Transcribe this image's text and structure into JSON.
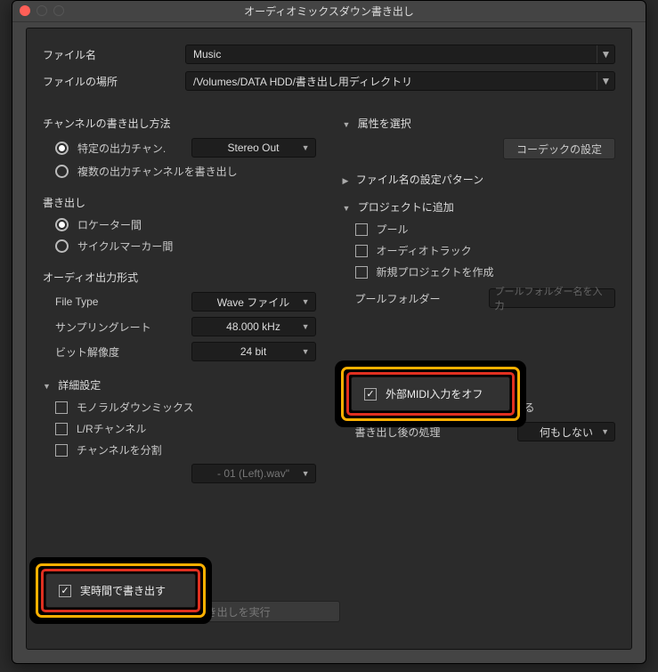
{
  "window": {
    "title": "オーディオミックスダウン書き出し"
  },
  "file": {
    "name_label": "ファイル名",
    "name_value": "Music",
    "path_label": "ファイルの場所",
    "path_value": "/Volumes/DATA HDD/書き出し用ディレクトリ"
  },
  "left": {
    "channel_method": "チャンネルの書き出し方法",
    "specific_channel": "特定の出力チャン.",
    "stereo_out": "Stereo Out",
    "multi_channel": "複数の出力チャンネルを書き出し",
    "export": "書き出し",
    "locator": "ロケーター間",
    "cycle_marker": "サイクルマーカー間",
    "audio_format": "オーディオ出力形式",
    "file_type": "File Type",
    "file_type_value": "Wave ファイル",
    "sample_rate": "サンプリングレート",
    "sample_rate_value": "48.000 kHz",
    "bit_depth": "ビット解像度",
    "bit_depth_value": "24 bit",
    "advanced": "詳細設定",
    "mono_downmix": "モノラルダウンミックス",
    "lr_channel": "L/Rチャンネル",
    "split_channel": "チャンネルを分割",
    "split_filename": "- 01 (Left).wav\"",
    "realtime": "実時間で書き出す",
    "execute": "オーディオの書き出しを実行"
  },
  "right": {
    "attributes": "属性を選択",
    "codec": "コーデックの設定",
    "filename_pattern": "ファイル名の設定パターン",
    "add_to_project": "プロジェクトに追加",
    "pool": "プール",
    "audio_track": "オーディオトラック",
    "new_project": "新規プロジェクトを作成",
    "pool_folder": "プールフォルダー",
    "pool_folder_placeholder": "プールフォルダー名を入力",
    "ext_midi_off": "外部MIDI入力をオフ",
    "close_after": "書き出し完了後ウィンドウを閉じる",
    "post_process": "書き出し後の処理",
    "post_process_value": "何もしない"
  }
}
